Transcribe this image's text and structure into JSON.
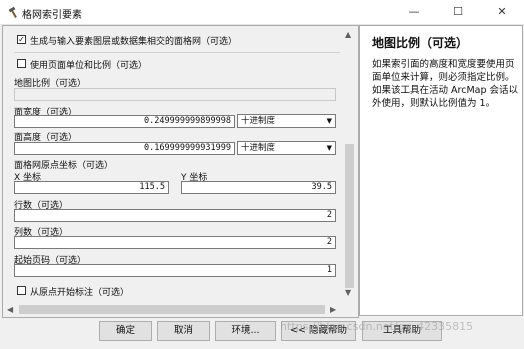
{
  "window": {
    "title": "格网索引要素",
    "minimize": "—",
    "maximize": "☐",
    "close": "✕"
  },
  "form": {
    "generate_checkbox": {
      "label": "生成与输入要素图层或数据集相交的面格网（可选）",
      "checked": true
    },
    "use_page_units": {
      "label": "使用页面单位和比例（可选）",
      "checked": false
    },
    "map_scale": {
      "label": "地图比例（可选）",
      "value": ""
    },
    "polygon_width": {
      "label": "面宽度（可选）",
      "value": "0.249999999899998",
      "unit": "十进制度"
    },
    "polygon_height": {
      "label": "面高度（可选）",
      "value": "0.169999999931999",
      "unit": "十进制度"
    },
    "origin": {
      "label": "面格网原点坐标（可选）",
      "x_label": "X 坐标",
      "x_value": "115.5",
      "y_label": "Y 坐标",
      "y_value": "39.5"
    },
    "rows": {
      "label": "行数（可选）",
      "value": "2"
    },
    "columns": {
      "label": "列数（可选）",
      "value": "2"
    },
    "start_page": {
      "label": "起始页码（可选）",
      "value": "1"
    },
    "label_from_origin": {
      "label": "从原点开始标注（可选）",
      "checked": false
    }
  },
  "help": {
    "title": "地图比例（可选）",
    "body": "如果索引面的高度和宽度要使用页面单位来计算，则必须指定比例。如果该工具在活动 ArcMap 会话以外使用，则默认比例值为 1。"
  },
  "buttons": {
    "ok": "确定",
    "cancel": "取消",
    "env": "环境...",
    "hide_help": "<< 隐藏帮助",
    "tool_help": "工具帮助"
  },
  "watermark": "https://blog.csdn.net/qq_42335815",
  "colors": {
    "scroll_thumb": "#cdcdcd",
    "button_bg": "#e1e1e1"
  }
}
